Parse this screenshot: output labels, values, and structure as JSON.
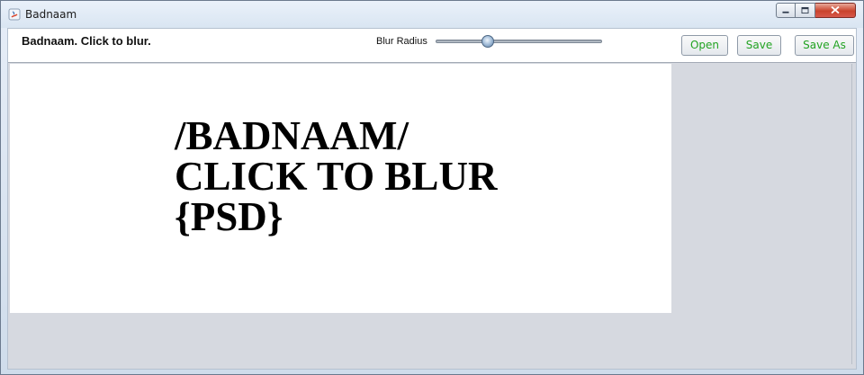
{
  "window": {
    "title": "Badnaam",
    "controls": {
      "minimize": "minimize",
      "maximize": "maximize",
      "close": "close"
    }
  },
  "toolbar": {
    "status_text": "Badnaam. Click to blur.",
    "blur_radius_label": "Blur Radius",
    "blur_radius_value": 0.3,
    "buttons": {
      "open": "Open",
      "save": "Save",
      "save_as": "Save As"
    }
  },
  "canvas": {
    "lines": [
      "/BADNAAM/",
      "CLICK TO BLUR",
      "{PSD}"
    ]
  },
  "colors": {
    "button_text": "#22a322",
    "canvas_background": "#ffffff",
    "workspace_background": "#d6d9e0"
  }
}
